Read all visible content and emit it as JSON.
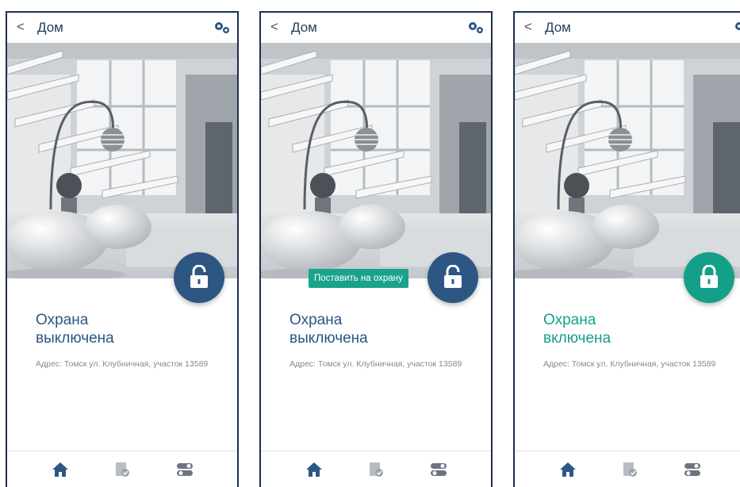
{
  "screens": [
    {
      "header": {
        "title": "Дом",
        "back_icon": "chevron-left-icon",
        "settings_icon": "gears-icon"
      },
      "fab": {
        "icon": "lock-open-icon",
        "color": "#2d5683"
      },
      "status": {
        "line1": "Охрана",
        "line2": "выключена",
        "color": "#2d5683"
      },
      "address": "Адрес: Томск  ул. Клубничная, участок 13589",
      "nav": [
        "home-icon",
        "checklist-icon",
        "toggles-icon"
      ]
    },
    {
      "header": {
        "title": "Дом",
        "back_icon": "chevron-left-icon",
        "settings_icon": "gears-icon"
      },
      "fab": {
        "icon": "lock-open-icon",
        "color": "#2d5683"
      },
      "tooltip": "Поставить на охрану",
      "status": {
        "line1": "Охрана",
        "line2": "выключена",
        "color": "#2d5683"
      },
      "address": "Адрес: Томск  ул. Клубничная, участок 13589",
      "nav": [
        "home-icon",
        "checklist-icon",
        "toggles-icon"
      ]
    },
    {
      "header": {
        "title": "Дом",
        "back_icon": "chevron-left-icon",
        "settings_icon": "gears-icon"
      },
      "fab": {
        "icon": "lock-closed-icon",
        "color": "#14a088"
      },
      "status": {
        "line1": "Охрана",
        "line2": "включена",
        "color": "#14a088"
      },
      "address": "Адрес: Томск  ул. Клубничная, участок 13589",
      "nav": [
        "home-icon",
        "checklist-icon",
        "toggles-icon"
      ]
    }
  ],
  "back_glyph": "<"
}
